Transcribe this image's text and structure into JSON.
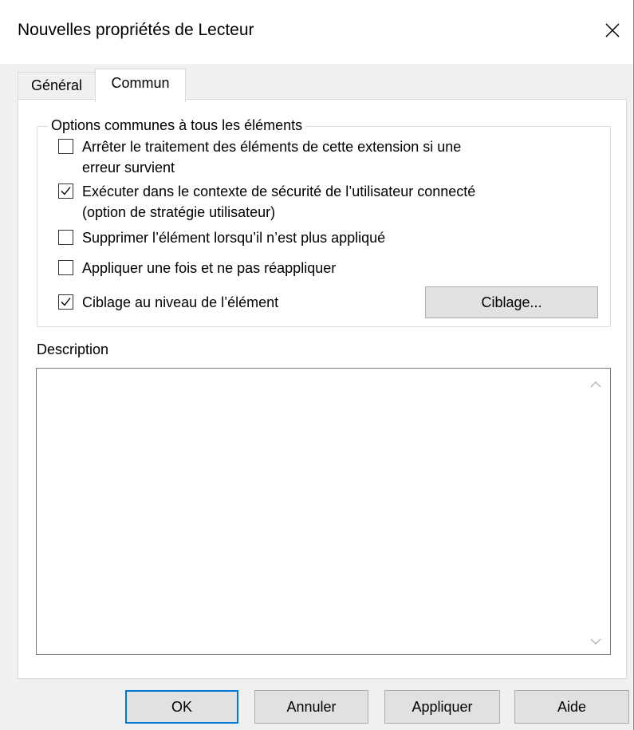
{
  "window": {
    "title": "Nouvelles propriétés de Lecteur"
  },
  "tabs": [
    {
      "label": "Général",
      "selected": false
    },
    {
      "label": "Commun",
      "selected": true
    }
  ],
  "options_group": {
    "legend": "Options communes à tous les éléments",
    "items": [
      {
        "line1": "Arrêter le traitement des éléments de cette extension si une",
        "line2": "erreur survient",
        "checked": false
      },
      {
        "line1": "Exécuter dans le contexte de sécurité de l’utilisateur connecté",
        "line2": "(option de stratégie utilisateur)",
        "checked": true
      },
      {
        "line1": "Supprimer l’élément lorsqu’il n’est plus appliqué",
        "checked": false
      },
      {
        "line1": "Appliquer une fois et ne pas réappliquer",
        "checked": false
      },
      {
        "line1": "Ciblage au niveau de l’élément",
        "checked": true
      }
    ],
    "targeting_button": "Ciblage..."
  },
  "description": {
    "label": "Description",
    "value": ""
  },
  "buttons": {
    "ok": "OK",
    "cancel": "Annuler",
    "apply": "Appliquer",
    "help": "Aide"
  },
  "icons": {
    "close": "close-icon",
    "check": "check-icon",
    "scroll_up": "chevron-up-icon",
    "scroll_down": "chevron-down-icon"
  },
  "colors": {
    "accent": "#0078d7",
    "button_face": "#e1e1e1",
    "window_bg": "#f0f0f0"
  }
}
